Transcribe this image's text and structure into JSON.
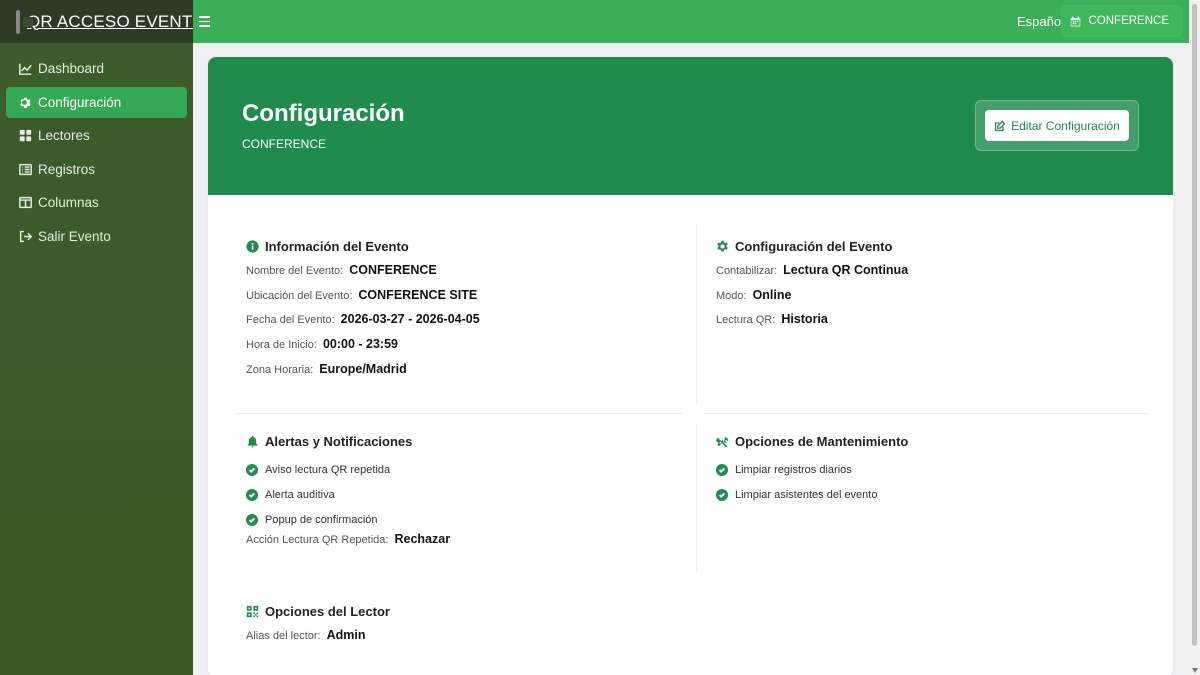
{
  "app": {
    "title": "QR ACCESO EVENTO"
  },
  "sidebar": {
    "items": [
      {
        "label": "Dashboard",
        "icon": "chart-line-icon"
      },
      {
        "label": "Configuración",
        "icon": "gear-icon",
        "active": true
      },
      {
        "label": "Lectores",
        "icon": "grid-icon"
      },
      {
        "label": "Registros",
        "icon": "list-icon"
      },
      {
        "label": "Columnas",
        "icon": "columns-icon"
      },
      {
        "label": "Salir Evento",
        "icon": "sign-out-icon"
      }
    ]
  },
  "topbar": {
    "language": "Español",
    "event": "CONFERENCE"
  },
  "hero": {
    "title": "Configuración",
    "subtitle": "CONFERENCE",
    "edit_label": "Editar Configuración"
  },
  "info": {
    "title": "Información del Evento",
    "rows": [
      {
        "label": "Nombre del Evento:",
        "value": "CONFERENCE"
      },
      {
        "label": "Ubicación del Evento:",
        "value": "CONFERENCE SITE"
      },
      {
        "label": "Fecha del Evento:",
        "value": "2026-03-27 - 2026-04-05"
      },
      {
        "label": "Hora de Inicio:",
        "value": "00:00 - 23:59"
      },
      {
        "label": "Zona Horaria:",
        "value": "Europe/Madrid"
      }
    ]
  },
  "config": {
    "title": "Configuración del Evento",
    "rows": [
      {
        "label": "Contabilizar:",
        "value": "Lectura QR Continua"
      },
      {
        "label": "Modo:",
        "value": "Online"
      },
      {
        "label": "Lectura QR:",
        "value": "Historia"
      }
    ]
  },
  "alerts": {
    "title": "Alertas y Notificaciones",
    "checks": [
      "Aviso lectura QR repetida",
      "Alerta auditiva",
      "Popup de confirmación"
    ],
    "row": {
      "label": "Acción Lectura QR Repetida:",
      "value": "Rechazar"
    }
  },
  "maintenance": {
    "title": "Opciones de Mantenimiento",
    "checks": [
      "Limpiar registros diarios",
      "Limpiar asistentes del evento"
    ]
  },
  "reader": {
    "title": "Opciones del Lector",
    "row": {
      "label": "Alias del lector:",
      "value": "Admin"
    }
  },
  "colors": {
    "primary": "#1f8c4d",
    "accent": "#34a853",
    "topbar": "#3bb058",
    "sidebar": "#3a5a26"
  }
}
